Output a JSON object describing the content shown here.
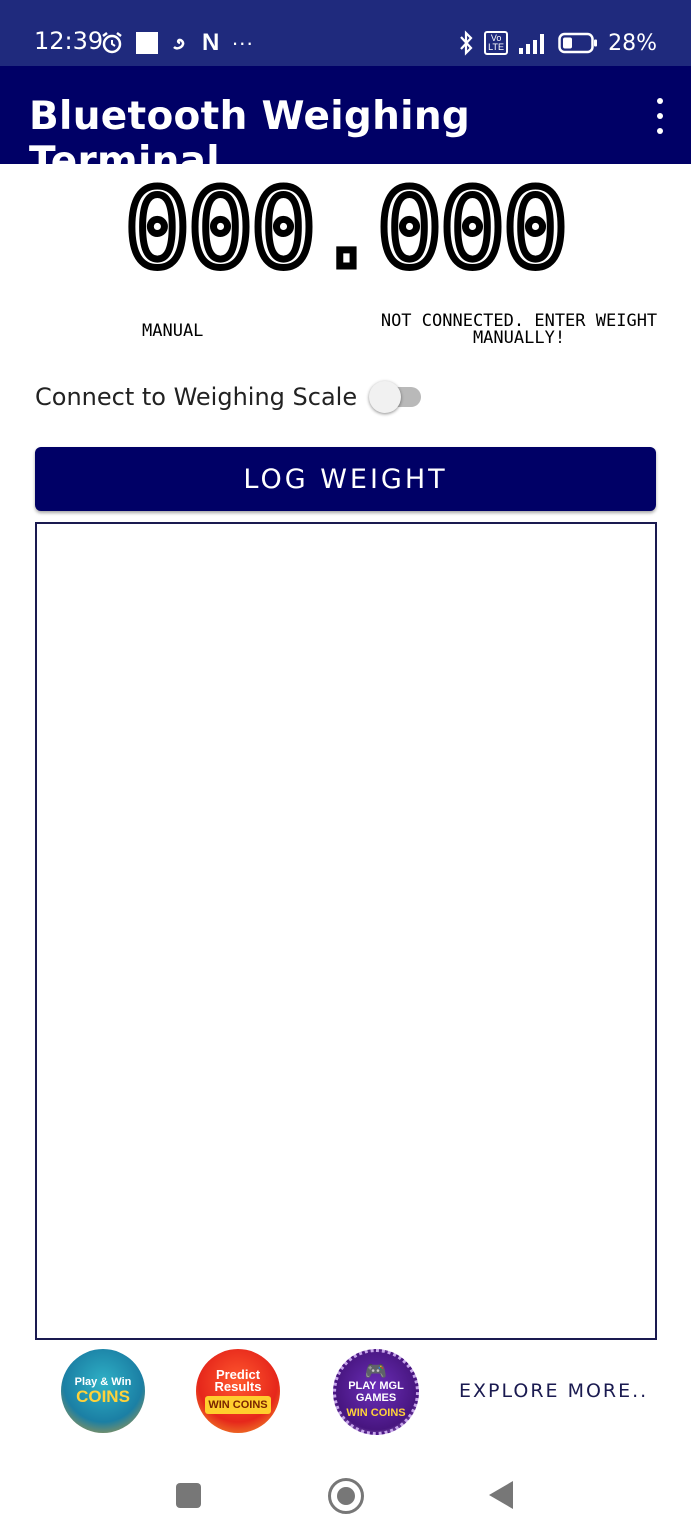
{
  "status_bar": {
    "time": "12:39",
    "left_icons": [
      "alarm-icon",
      "square-icon",
      "app-icon",
      "netflix-icon",
      "more-icon"
    ],
    "netflix_glyph": "N",
    "more_glyph": "···",
    "right_icons": [
      "bluetooth-icon",
      "volte-icon",
      "signal-icon",
      "battery-icon"
    ],
    "volte_text": "Vo LTE",
    "battery_percent": "28%"
  },
  "app_bar": {
    "title": "Bluetooth Weighing Terminal..."
  },
  "display": {
    "weight": "000.000",
    "mode": "MANUAL",
    "status": "NOT CONNECTED. ENTER WEIGHT MANUALLY!"
  },
  "connect": {
    "label": "Connect to Weighing Scale",
    "on": false
  },
  "log_button": {
    "label": "LOG WEIGHT"
  },
  "promos": [
    {
      "line1": "Play & Win",
      "line2": "COINS"
    },
    {
      "line1": "Predict Results",
      "line2": "WIN COINS"
    },
    {
      "line1": "PLAY MGL GAMES",
      "line2": "WIN COINS"
    }
  ],
  "explore_label": "EXPLORE MORE..",
  "colors": {
    "status_bar": "#1f2a7d",
    "app_bar": "#000066",
    "button": "#000066"
  }
}
